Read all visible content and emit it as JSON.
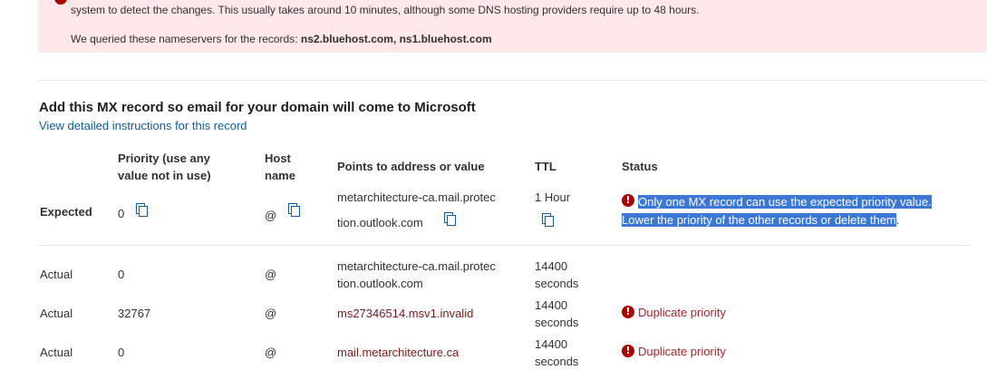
{
  "alert": {
    "line1": "system to detect the changes. This usually takes around 10 minutes, although some DNS hosting providers require up to 48 hours.",
    "line2_prefix": "We queried these nameservers for the records: ",
    "nameservers": "ns2.bluehost.com, ns1.bluehost.com"
  },
  "section": {
    "title": "Add this MX record so email for your domain will come to Microsoft",
    "instructions_link": "View detailed instructions for this record"
  },
  "table": {
    "headers": {
      "priority_line1": "Priority (use any",
      "priority_line2": "value not in use)",
      "host_line1": "Host",
      "host_line2": "name",
      "points_to": "Points to address or value",
      "ttl": "TTL",
      "status": "Status"
    },
    "expected": {
      "label": "Expected",
      "priority": "0",
      "host": "@",
      "points_line1": "metarchitecture-ca.mail.protec",
      "points_line2": "tion.outlook.com",
      "ttl": "1 Hour",
      "status_line1": "Only one MX record can use the expected priority value.",
      "status_line2": "Lower the priority of the other records or delete them",
      "status_tail": "."
    },
    "actual": [
      {
        "label": "Actual",
        "priority": "0",
        "host": "@",
        "points_line1": "metarchitecture-ca.mail.protec",
        "points_line2": "tion.outlook.com",
        "ttl_line1": "14400",
        "ttl_line2": "seconds",
        "status": ""
      },
      {
        "label": "Actual",
        "priority": "32767",
        "host": "@",
        "points": "ms27346514.msv1.invalid",
        "ttl_line1": "14400",
        "ttl_line2": "seconds",
        "status": "Duplicate priority"
      },
      {
        "label": "Actual",
        "priority": "0",
        "host": "@",
        "points": "mail.metarchitecture.ca",
        "ttl_line1": "14400",
        "ttl_line2": "seconds",
        "status": "Duplicate priority"
      }
    ]
  },
  "icons": {
    "copy": "copy-icon",
    "error": "error-icon",
    "error_glyph": "!"
  },
  "colors": {
    "alert_bg": "#fde7e9",
    "link": "#0f5e97",
    "error": "#a80000",
    "selection": "#3a78d4"
  }
}
